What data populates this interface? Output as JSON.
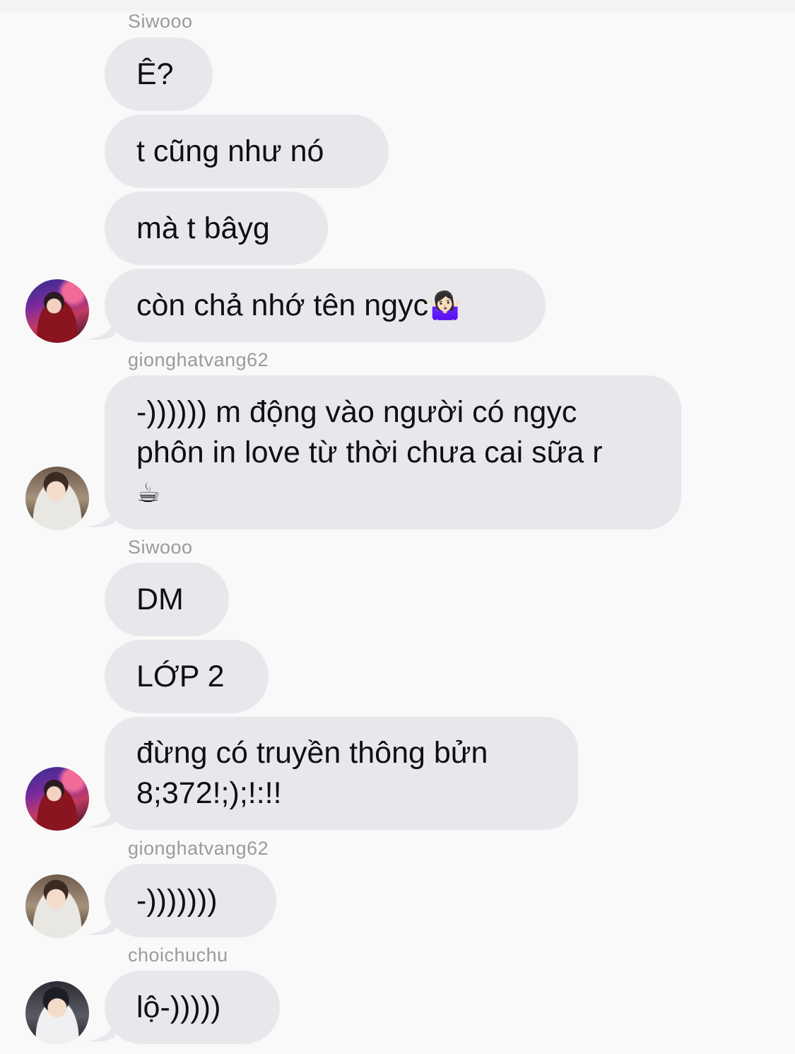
{
  "messages": {
    "sender_1": "Siwooo",
    "m1": "Ê?",
    "m2": "t cũng như nó",
    "m3": "mà t bâyg",
    "m4_text": "còn chả nhớ tên ngyc",
    "m4_emoji": "🤷🏻‍♀️",
    "sender_2": "gionghatvang62",
    "m5_line1": "-)))))) m động vào người có ngyc",
    "m5_line2": "phôn in love từ thời chưa cai sữa r",
    "m5_emoji": "☕",
    "sender_3": "Siwooo",
    "m6": "DM",
    "m7": "LỚP 2",
    "m8_line1": "đừng có truyền thông bửn",
    "m8_line2": "8;372!;);!:!!",
    "sender_4": "gionghatvang62",
    "m9": "-)))))))",
    "sender_5": "choichuchu",
    "m10": "lộ-)))))"
  },
  "colors": {
    "bubble": "#e8e7ec",
    "sender_label": "#9b9b9f",
    "background": "#f9f9f9"
  },
  "icons": [
    "avatar-siwooo",
    "avatar-gionghatvang62",
    "avatar-choichuchu",
    "shrug-emoji",
    "coffee-emoji"
  ]
}
